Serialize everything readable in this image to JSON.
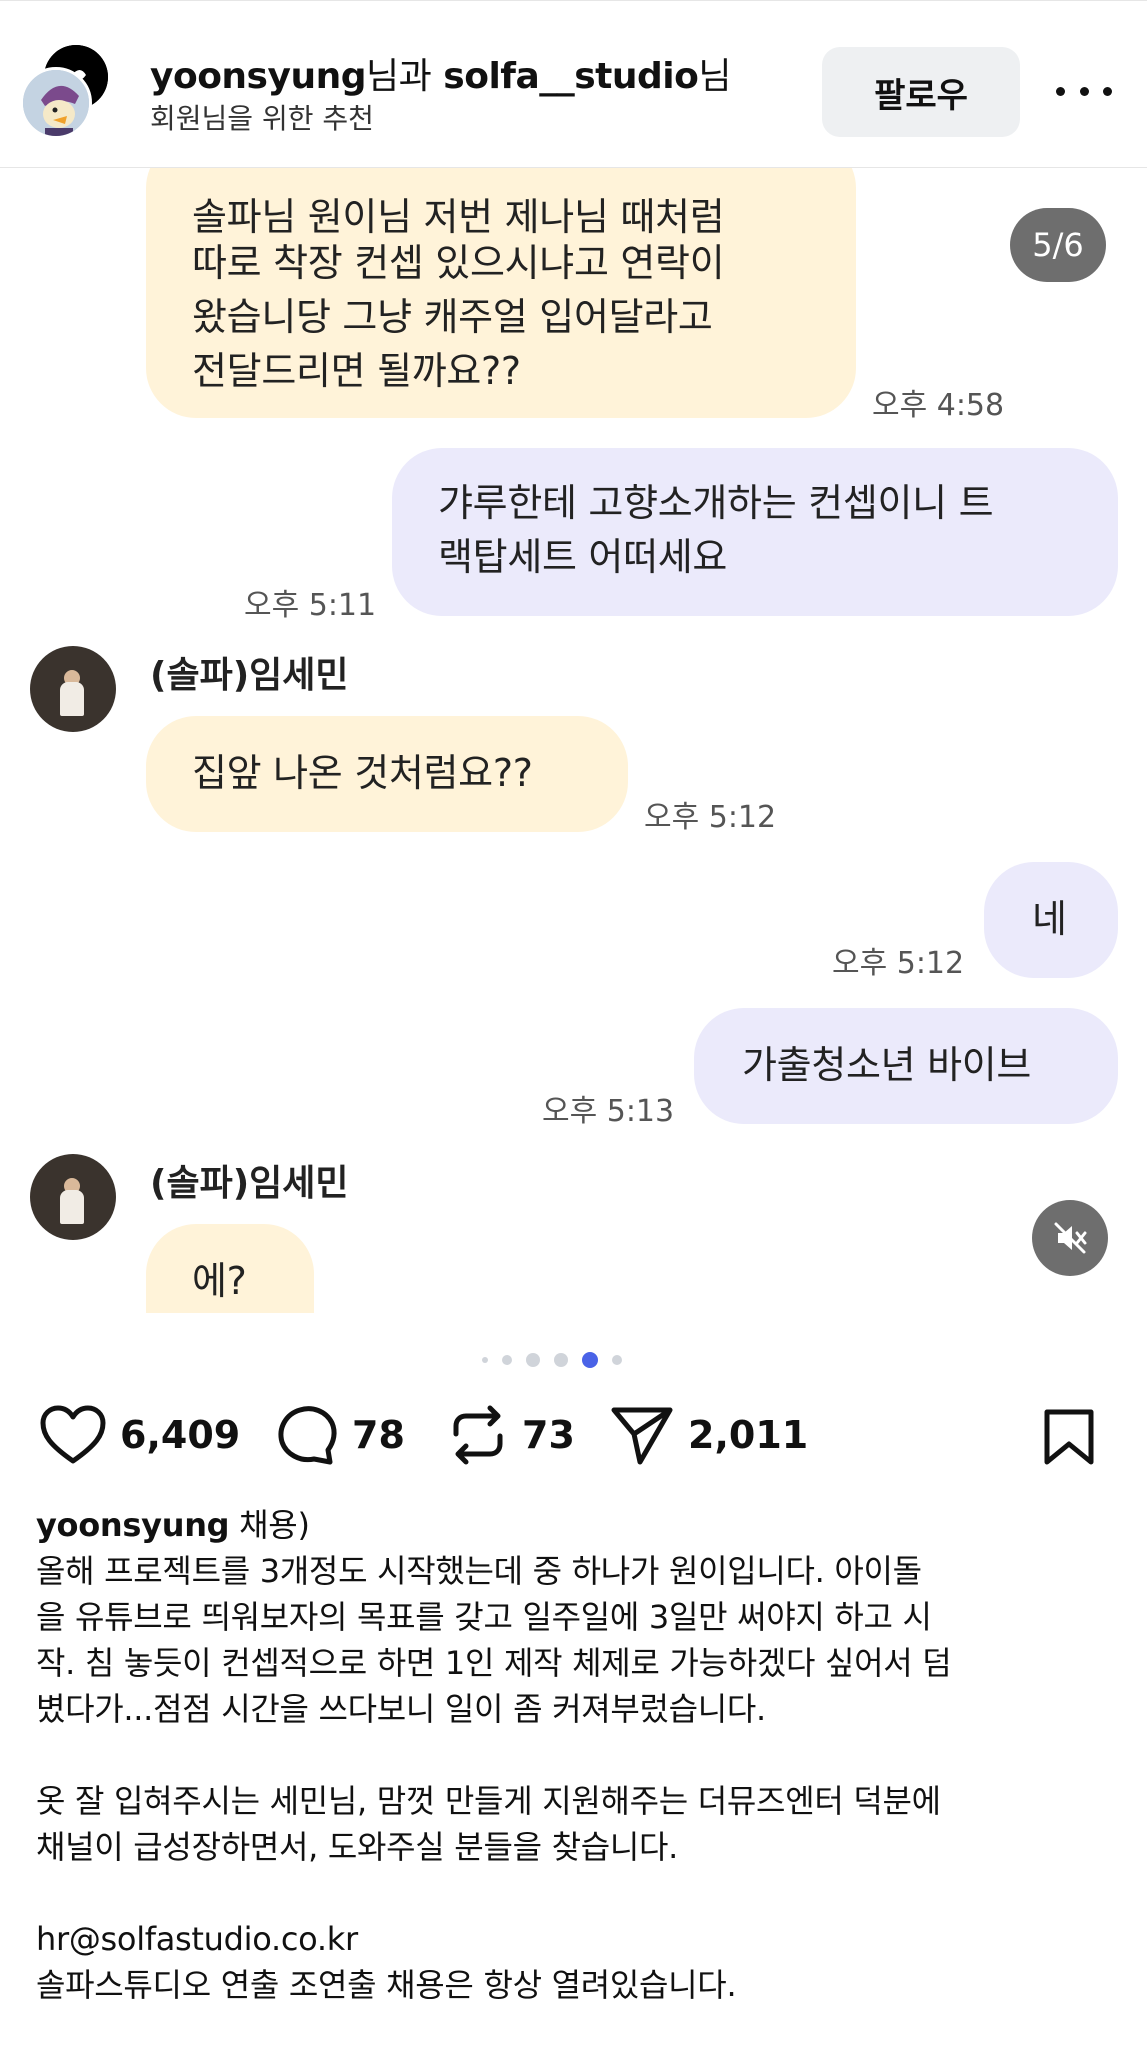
{
  "header": {
    "user1": "yoonsyung",
    "connector": "님과",
    "user2": "solfa__studio",
    "suffix": "님",
    "subtitle": "회원님을 위한 추천",
    "follow_label": "팔로우"
  },
  "chat": {
    "page_indicator": "5/6",
    "messages": [
      {
        "type": "received",
        "lines": [
          "솔파님 원이님 저번 제나님 때처럼",
          "따로 착장 컨셉 있으시냐고 연락이",
          "왔습니당 그냥 캐주얼 입어달라고",
          "전달드리면 될까요??"
        ],
        "time": "오후 4:58"
      },
      {
        "type": "sent",
        "lines": [
          "갸루한테 고향소개하는 컨셉이니 트",
          "랙탑세트 어떠세요"
        ],
        "time": "오후 5:11"
      },
      {
        "type": "received",
        "sender": "(솔파)임세민",
        "lines": [
          "집앞 나온 것처럼요??"
        ],
        "time": "오후 5:12"
      },
      {
        "type": "sent",
        "lines": [
          "네"
        ],
        "time": "오후 5:12"
      },
      {
        "type": "sent",
        "lines": [
          "가출청소년 바이브"
        ],
        "time": "오후 5:13"
      },
      {
        "type": "received",
        "sender": "(솔파)임세민",
        "lines": [
          "에?"
        ]
      }
    ]
  },
  "carousel": {
    "total": 6,
    "active": 5
  },
  "actions": {
    "likes": "6,409",
    "comments": "78",
    "reposts": "73",
    "shares": "2,011"
  },
  "caption": {
    "username": "yoonsyung",
    "first_line_rest": " 채용)",
    "paragraph1": [
      "올해 프로젝트를 3개정도 시작했는데 중 하나가 원이입니다. 아이돌",
      "을 유튜브로 띄워보자의 목표를 갖고 일주일에 3일만 써야지 하고 시",
      "작. 침 놓듯이 컨셉적으로 하면 1인 제작 체제로 가능하겠다 싶어서 덤",
      "볐다가...점점 시간을 쓰다보니 일이 좀 커져부렀습니다."
    ],
    "paragraph2": [
      "옷 잘 입혀주시는 세민님, 맘껏 만들게 지원해주는 더뮤즈엔터 덕분에",
      "채널이 급성장하면서, 도와주실 분들을 찾습니다."
    ],
    "email": "hr@solfastudio.co.kr",
    "closing": "솔파스튜디오 연출 조연출 채용은 항상 열려있습니다."
  }
}
